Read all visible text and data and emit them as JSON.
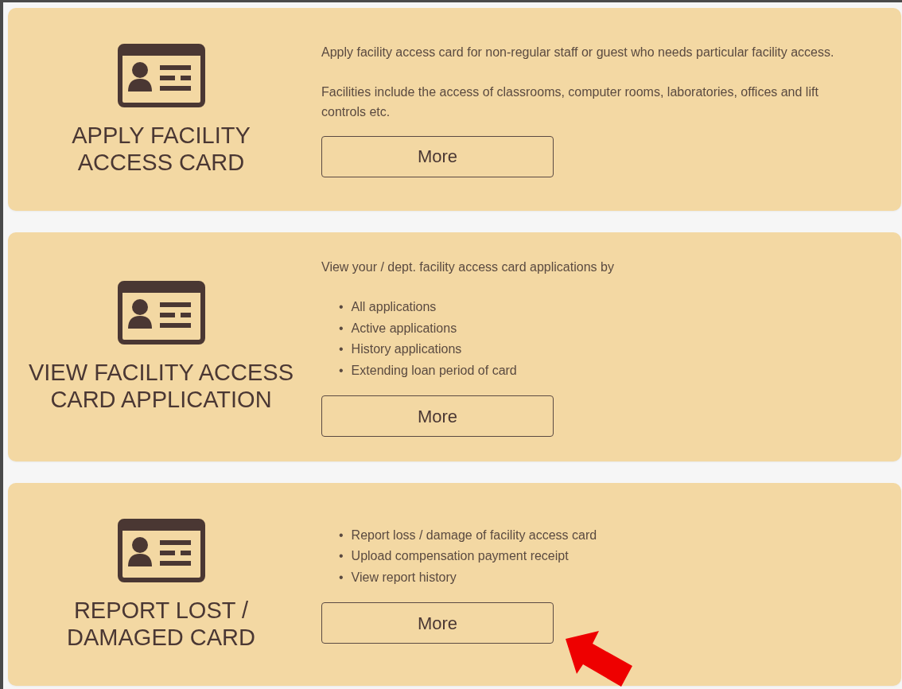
{
  "cards": [
    {
      "title_lines": [
        "APPLY FACILITY",
        "ACCESS CARD"
      ],
      "blocks": [
        {
          "kind": "paragraph",
          "text": "Apply facility access card for non-regular staff or guest who needs particular facility access."
        },
        {
          "kind": "paragraph",
          "text": "Facilities include the access of classrooms, computer rooms, laboratories, offices and lift controls etc."
        }
      ],
      "button": "More"
    },
    {
      "title_lines": [
        "VIEW FACILITY ACCESS",
        "CARD APPLICATION"
      ],
      "blocks": [
        {
          "kind": "paragraph",
          "text": "View your / dept. facility access card applications by"
        },
        {
          "kind": "list",
          "items": [
            {
              "marker": "•",
              "text": "All applications"
            },
            {
              "marker": "•",
              "text": "Active applications"
            },
            {
              "marker": "•",
              "text": "History applications"
            },
            {
              "marker": "•",
              "text": "Extending loan period of card"
            }
          ]
        }
      ],
      "button": "More"
    },
    {
      "title_lines": [
        "REPORT LOST /",
        "DAMAGED CARD"
      ],
      "blocks": [
        {
          "kind": "list",
          "items": [
            {
              "marker": "•",
              "text": "Report loss / damage of facility access card"
            },
            {
              "marker": "•",
              "text": "Upload compensation payment receipt"
            },
            {
              "marker": "•",
              "text": "View report history"
            }
          ]
        }
      ],
      "button": "More"
    }
  ]
}
